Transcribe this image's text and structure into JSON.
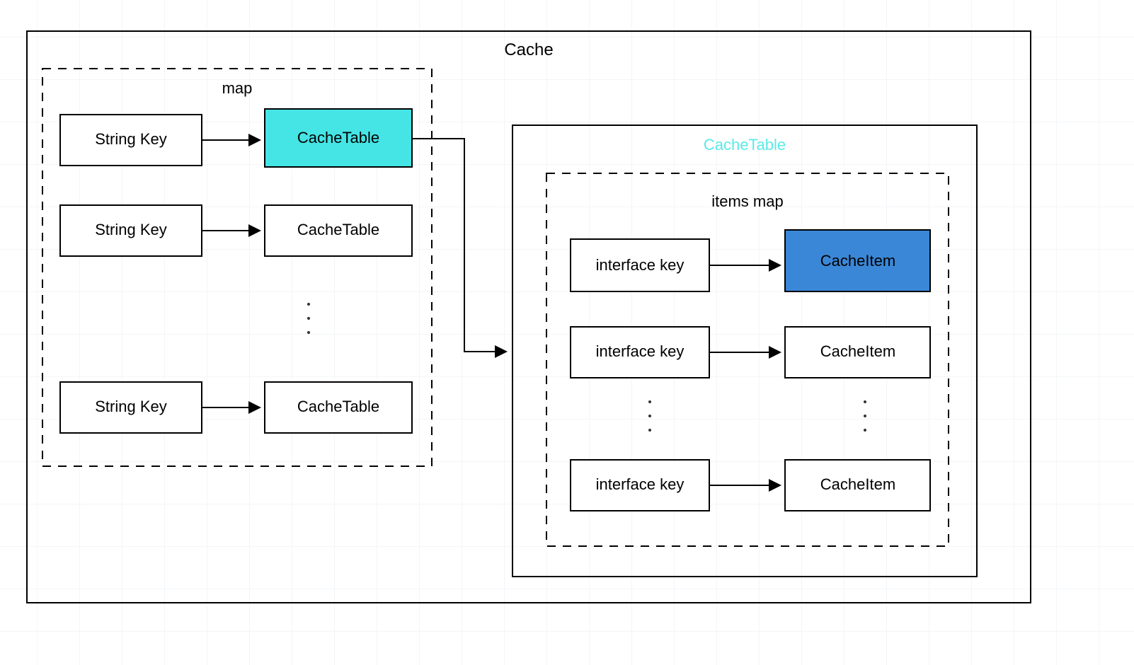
{
  "title": "Cache",
  "cacheTableDetail": {
    "title": "CacheTable"
  },
  "map": {
    "title": "map",
    "rows": [
      {
        "key": "String Key",
        "value": "CacheTable"
      },
      {
        "key": "String Key",
        "value": "CacheTable"
      },
      {
        "key": "String Key",
        "value": "CacheTable"
      }
    ]
  },
  "itemsMap": {
    "title": "items map",
    "rows": [
      {
        "key": "interface key",
        "value": "CacheItem"
      },
      {
        "key": "interface key",
        "value": "CacheItem"
      },
      {
        "key": "interface key",
        "value": "CacheItem"
      }
    ]
  },
  "colors": {
    "stroke": "#000000",
    "highlightCyan": "#45e5e5",
    "highlightBlue": "#3a87d7",
    "cyanText": "#5ce9e9"
  }
}
